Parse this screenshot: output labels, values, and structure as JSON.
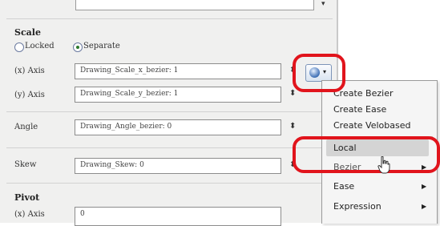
{
  "top": {
    "arrow": "▾"
  },
  "scale": {
    "title": "Scale",
    "locked_label": "Locked",
    "separate_label": "Separate",
    "x_axis": {
      "label": "(x) Axis",
      "value": "Drawing_Scale_x_bezier: 1"
    },
    "y_axis": {
      "label": "(y) Axis",
      "value": "Drawing_Scale_y_bezier: 1"
    }
  },
  "angle": {
    "label": "Angle",
    "value": "Drawing_Angle_bezier: 0"
  },
  "skew": {
    "label": "Skew",
    "value": "Drawing_Skew: 0"
  },
  "pivot": {
    "title": "Pivot",
    "x_axis": {
      "label": "(x) Axis",
      "value": "0"
    }
  },
  "spinner_symbol": "⬍",
  "function_button": {
    "caret": "▾"
  },
  "menu": {
    "items": [
      {
        "label": "Create Bezier"
      },
      {
        "label": "Create Ease"
      },
      {
        "label": "Create Velobased"
      },
      {
        "label": "Local"
      },
      {
        "label": "Bezier"
      },
      {
        "label": "Ease"
      },
      {
        "label": "Expression"
      }
    ],
    "submenu_arrow": "▶"
  },
  "colors": {
    "annotation_ring": "#e1141c",
    "panel_bg": "#f0f0ef",
    "menu_highlight": "#d4d4d4"
  }
}
